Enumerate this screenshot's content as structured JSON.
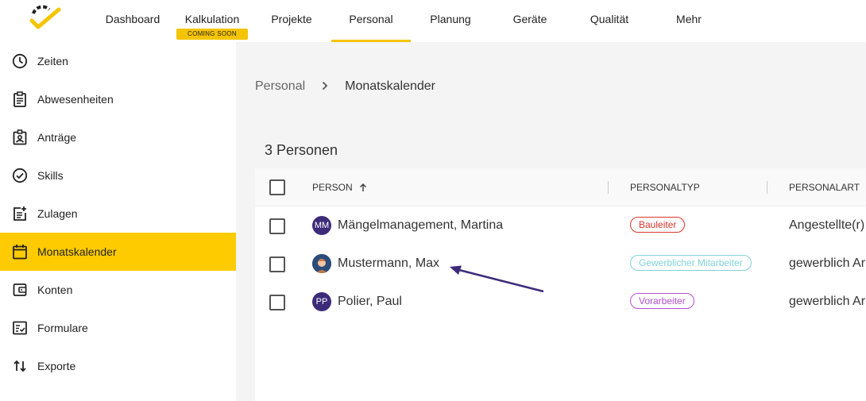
{
  "nav": {
    "items": [
      {
        "label": "Dashboard"
      },
      {
        "label": "Kalkulation",
        "badge": "COMING SOON"
      },
      {
        "label": "Projekte"
      },
      {
        "label": "Personal"
      },
      {
        "label": "Planung"
      },
      {
        "label": "Geräte"
      },
      {
        "label": "Qualität"
      },
      {
        "label": "Mehr"
      }
    ],
    "active": "Personal",
    "accent": "#f5c400"
  },
  "sidebar": {
    "items": [
      {
        "label": "Zeiten",
        "icon": "clock-icon"
      },
      {
        "label": "Abwesenheiten",
        "icon": "clipboard-icon"
      },
      {
        "label": "Anträge",
        "icon": "badge-icon"
      },
      {
        "label": "Skills",
        "icon": "check-circle-icon"
      },
      {
        "label": "Zulagen",
        "icon": "post-add-icon"
      },
      {
        "label": "Monatskalender",
        "icon": "calendar-icon"
      },
      {
        "label": "Konten",
        "icon": "wallet-icon"
      },
      {
        "label": "Formulare",
        "icon": "checklist-icon"
      },
      {
        "label": "Exporte",
        "icon": "swap-vert-icon"
      }
    ],
    "active": "Monatskalender",
    "active_color": "#fecb00"
  },
  "breadcrumb": {
    "parent": "Personal",
    "current": "Monatskalender"
  },
  "list": {
    "title": "3 Personen",
    "columns": {
      "person": "PERSON",
      "personaltyp": "PERSONALTYP",
      "personalart": "PERSONALART"
    },
    "rows": [
      {
        "initials": "MM",
        "name": "Mängelmanagement, Martina",
        "typ": "Bauleiter",
        "typ_color": "#d9352b",
        "art": "Angestellte(r)"
      },
      {
        "initials": "",
        "name": "Mustermann, Max",
        "typ": "Gewerblicher Mitarbeiter",
        "typ_color": "#7fd3d9",
        "art": "gewerblich Ar"
      },
      {
        "initials": "PP",
        "name": "Polier, Paul",
        "typ": "Vorarbeiter",
        "typ_color": "#b54fd0",
        "art": "gewerblich Ar"
      }
    ]
  },
  "annotation_color": "#3d2b7a"
}
